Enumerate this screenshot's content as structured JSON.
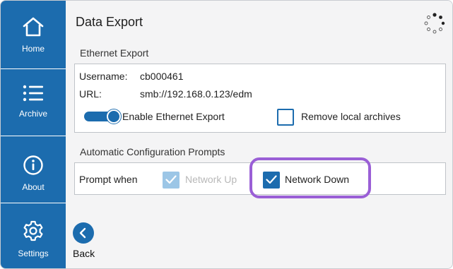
{
  "sidebar": {
    "items": [
      {
        "label": "Home",
        "icon": "home-icon"
      },
      {
        "label": "Archive",
        "icon": "list-icon"
      },
      {
        "label": "About",
        "icon": "info-icon"
      },
      {
        "label": "Settings",
        "icon": "gear-icon"
      }
    ],
    "color": "#1c6cae"
  },
  "header": {
    "title": "Data Export",
    "status_icon": "loading-spinner-icon"
  },
  "ethernet": {
    "section_label": "Ethernet Export",
    "username_label": "Username:",
    "username_value": "cb000461",
    "url_label": "URL:",
    "url_value": "smb://192.168.0.123/edm",
    "enable_label": "Enable Ethernet Export",
    "enable_on": true,
    "remove_label": "Remove local archives",
    "remove_checked": false
  },
  "prompts": {
    "section_label": "Automatic Configuration Prompts",
    "prompt_label": "Prompt when",
    "network_up_label": "Network Up",
    "network_up_checked": true,
    "network_up_disabled": true,
    "network_down_label": "Network Down",
    "network_down_checked": true,
    "highlight_color": "#9a5fd6"
  },
  "footer": {
    "back_label": "Back",
    "back_icon": "chevron-left-icon"
  }
}
